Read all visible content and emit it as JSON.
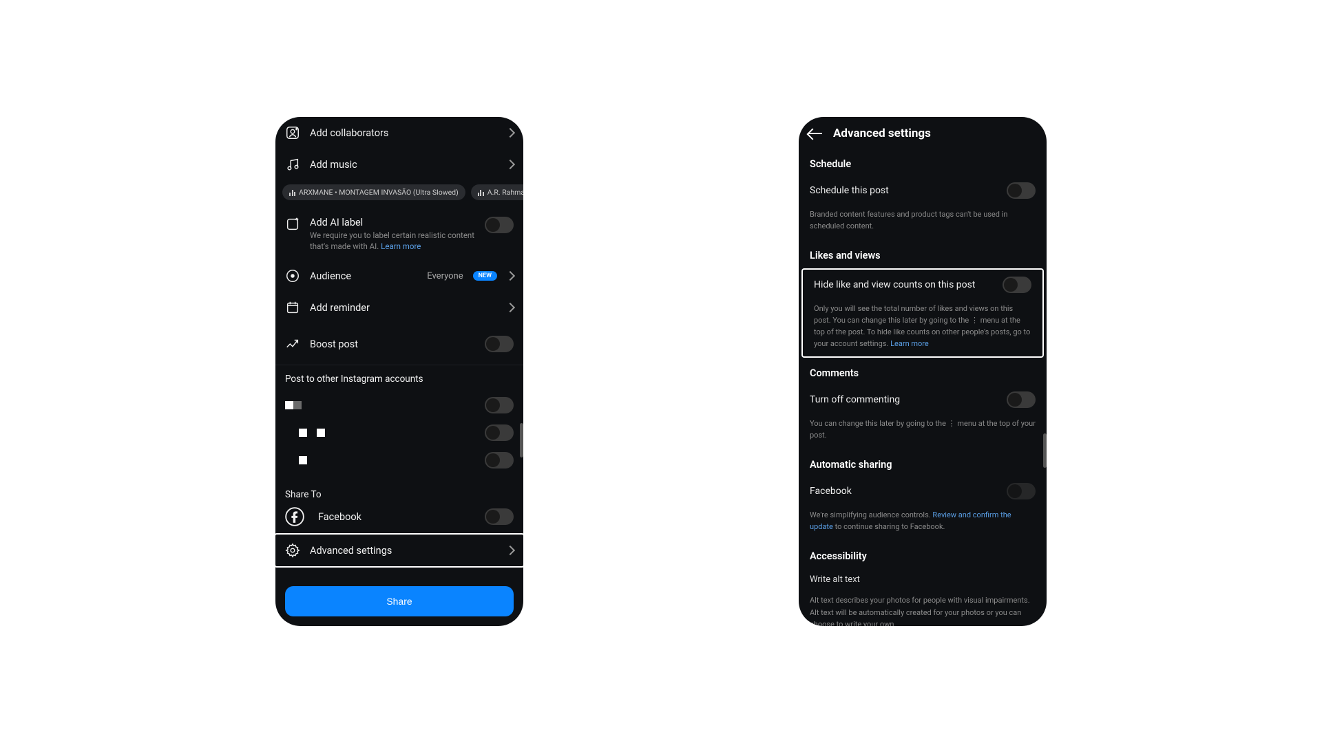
{
  "phone1": {
    "addCollaborators": "Add collaborators",
    "addMusic": "Add music",
    "musicChips": [
      "ARXMANE • MONTAGEM INVASÃO (Ultra Slowed)",
      "A.R. Rahman,"
    ],
    "aiLabel": {
      "title": "Add AI label",
      "desc": "We require you to label certain realistic content that's made with AI.",
      "link": "Learn more"
    },
    "audience": {
      "label": "Audience",
      "value": "Everyone",
      "badge": "NEW"
    },
    "addReminder": "Add reminder",
    "boostPost": "Boost post",
    "postOther": "Post to other Instagram accounts",
    "shareTo": "Share To",
    "facebook": "Facebook",
    "advanced": "Advanced settings",
    "shareBtn": "Share"
  },
  "phone2": {
    "title": "Advanced settings",
    "schedule": {
      "head": "Schedule",
      "label": "Schedule this post",
      "desc": "Branded content features and product tags can't be used in scheduled content."
    },
    "likes": {
      "head": "Likes and views",
      "label": "Hide like and view counts on this post",
      "desc": "Only you will see the total number of likes and views on this post. You can change this later by going to the ⋮ menu at the top of the post. To hide like counts on other people's posts, go to your account settings.",
      "link": "Learn more"
    },
    "comments": {
      "head": "Comments",
      "label": "Turn off commenting",
      "desc": "You can change this later by going to the ⋮ menu at the top of your post."
    },
    "autoShare": {
      "head": "Automatic sharing",
      "label": "Facebook",
      "descPre": "We're simplifying audience controls.",
      "link": "Review and confirm the update",
      "descPost": "to continue sharing to Facebook."
    },
    "accessibility": {
      "head": "Accessibility",
      "label": "Write alt text",
      "desc": "Alt text describes your photos for people with visual impairments. Alt text will be automatically created for your photos or you can choose to write your own."
    }
  }
}
